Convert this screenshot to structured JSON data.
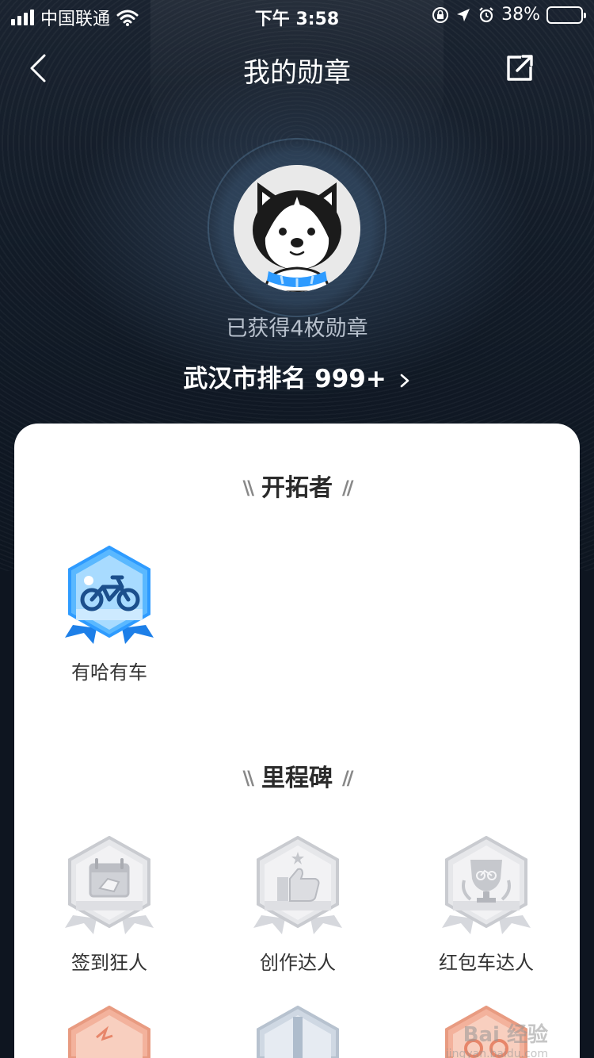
{
  "status_bar": {
    "carrier": "中国联通",
    "time": "下午 3:58",
    "battery": "38%",
    "battery_level": 0.38,
    "battery_color": "#ffd60a"
  },
  "nav": {
    "title": "我的勋章",
    "back_icon": "chevron-left-icon",
    "share_icon": "share-icon"
  },
  "profile": {
    "earned_text": "已获得4枚勋章",
    "rank_text": "武汉市排名 999+"
  },
  "sections": [
    {
      "title": "开拓者",
      "badges": [
        {
          "label": "有哈有车",
          "style": "blue",
          "icon": "bike-badge-icon"
        }
      ]
    },
    {
      "title": "里程碑",
      "badges": [
        {
          "label": "签到狂人",
          "style": "silver",
          "icon": "calendar-badge-icon"
        },
        {
          "label": "创作达人",
          "style": "silver",
          "icon": "thumbs-up-badge-icon"
        },
        {
          "label": "红包车达人",
          "style": "silver",
          "icon": "trophy-badge-icon"
        }
      ]
    }
  ],
  "watermark": {
    "brand": "Bai 经验",
    "url": "jingyan.baidu.com"
  },
  "colors": {
    "accent_blue": "#2e9bff",
    "silver": "#d9dbe0",
    "bronze": "#f0a98f"
  }
}
